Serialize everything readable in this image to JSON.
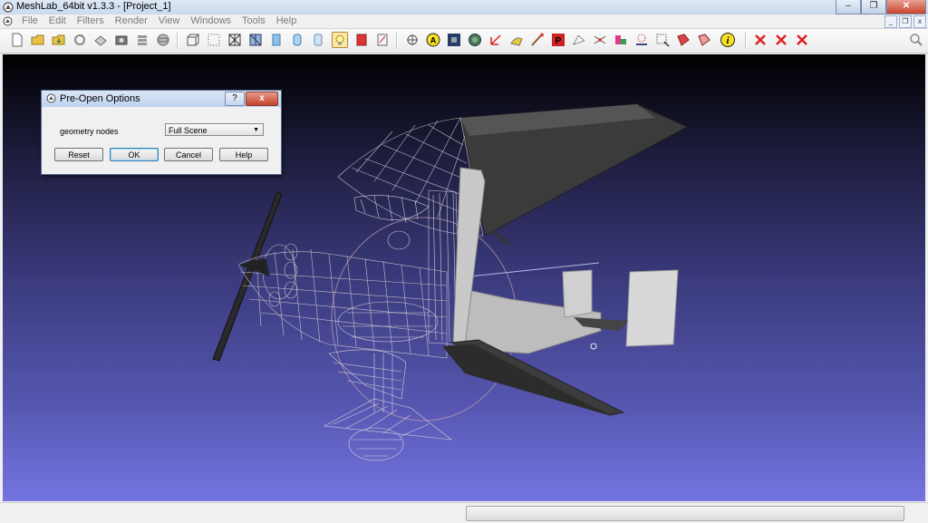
{
  "window": {
    "title": "MeshLab_64bit v1.3.3 - [Project_1]",
    "minimize": "–",
    "maximize": "❐",
    "close": "✕"
  },
  "menu": {
    "items": [
      "File",
      "Edit",
      "Filters",
      "Render",
      "View",
      "Windows",
      "Tools",
      "Help"
    ],
    "mdi": {
      "minimize": "_",
      "restore": "❐",
      "close": "x"
    }
  },
  "toolbar": {
    "icons": [
      "new-project-icon",
      "open-project-icon",
      "import-mesh-icon",
      "reload-icon",
      "export-mesh-icon",
      "snapshot-icon",
      "layers-icon",
      "trackball-icon",
      "bounding-box-icon",
      "points-icon",
      "wireframe-icon",
      "hidden-lines-icon",
      "flat-icon",
      "smooth-icon",
      "texture-icon",
      "light-icon",
      "color-icon",
      "double-side-icon",
      "select-vertices-icon",
      "annotate-icon",
      "texture-param-icon",
      "sphere-icon",
      "measure-icon",
      "paint-icon",
      "brush-icon",
      "pickpoints-icon",
      "align-icon",
      "manipulator-icon",
      "color-paint-icon",
      "reference-icon",
      "select-connected-icon",
      "select-faces-icon",
      "info-icon",
      "delete-icon",
      "delete-faces-icon",
      "delete-vertices-icon",
      "search-icon"
    ],
    "active": "light-icon"
  },
  "dialog": {
    "title": "Pre-Open Options",
    "help": "?",
    "close": "x",
    "field_label": "geometry nodes",
    "select_value": "Full Scene",
    "buttons": {
      "reset": "Reset",
      "ok": "OK",
      "cancel": "Cancel",
      "help": "Help"
    }
  },
  "colors": {
    "viewport_top": "#000000",
    "viewport_bottom": "#7474e0",
    "accent": "#3c7fb1"
  }
}
